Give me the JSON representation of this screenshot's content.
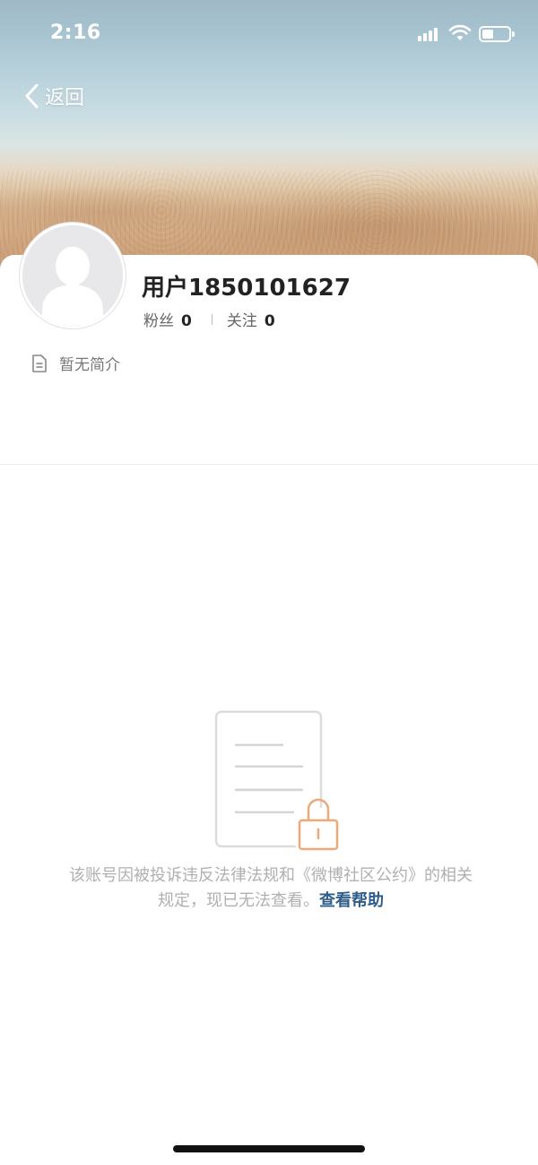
{
  "status_bar": {
    "time": "2:16",
    "icons": [
      "cellular-signal-icon",
      "wifi-icon",
      "battery-icon"
    ]
  },
  "nav": {
    "back_label": "返回",
    "back_icon": "chevron-left-icon"
  },
  "profile": {
    "username": "用户1850101627",
    "fans_label": "粉丝",
    "fans_count": "0",
    "following_label": "关注",
    "following_count": "0",
    "bio_icon": "document-icon",
    "bio": "暂无简介"
  },
  "notice": {
    "illustration_icon": "locked-document-icon",
    "message": "该账号因被投诉违反法律法规和《微博社区公约》的相关规定，现已无法查看。",
    "help_link": "查看帮助"
  },
  "colors": {
    "link": "#2f5d8a",
    "lock_accent": "#f0a878",
    "muted_text": "#b0b0b0"
  }
}
